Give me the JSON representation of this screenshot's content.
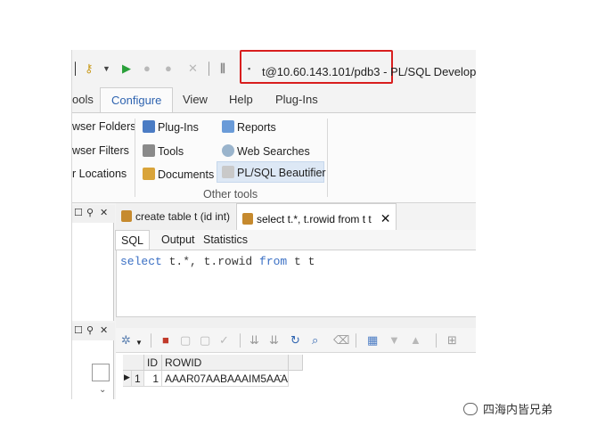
{
  "window": {
    "title": "t@10.60.143.101/pdb3 - PL/SQL Develop"
  },
  "ribbon": {
    "tabs": [
      {
        "label": "ools"
      },
      {
        "label": "Configure"
      },
      {
        "label": "View"
      },
      {
        "label": "Help"
      },
      {
        "label": "Plug-Ins"
      }
    ],
    "left_items": [
      "wser Folders",
      "wser Filters",
      "r Locations"
    ],
    "col1": [
      {
        "label": "Plug-Ins",
        "icon": "plugin-icon"
      },
      {
        "label": "Tools",
        "icon": "tools-icon"
      },
      {
        "label": "Documents",
        "icon": "documents-icon"
      }
    ],
    "col2": [
      {
        "label": "Reports",
        "icon": "reports-icon"
      },
      {
        "label": "Web Searches",
        "icon": "globe-icon"
      },
      {
        "label": "PL/SQL Beautifier",
        "icon": "beautifier-icon"
      }
    ],
    "group_label": "Other tools"
  },
  "panes": {
    "buttons": [
      "☐",
      "⚲",
      "✕"
    ]
  },
  "editor": {
    "tabs": [
      {
        "label": "create table t (id int)"
      },
      {
        "label": "select t.*, t.rowid from t t"
      }
    ],
    "close_glyph": "✕",
    "subtabs": [
      "SQL",
      "Output",
      "Statistics"
    ],
    "code": {
      "kw1": "select",
      "mid": " t.*, t.rowid ",
      "kw2": "from",
      "tail": " t t"
    }
  },
  "grid": {
    "columns": [
      "ID",
      "ROWID"
    ],
    "rows": [
      {
        "num": "1",
        "id": "1",
        "rowid": "AAAR07AABAAAIM5AAA",
        "more": "···"
      }
    ]
  },
  "watermark": {
    "text": "四海内皆兄弟"
  },
  "colors": {
    "highlight_border": "#d81e1e",
    "accent": "#2f64b0",
    "keyword": "#3a6fc4"
  }
}
